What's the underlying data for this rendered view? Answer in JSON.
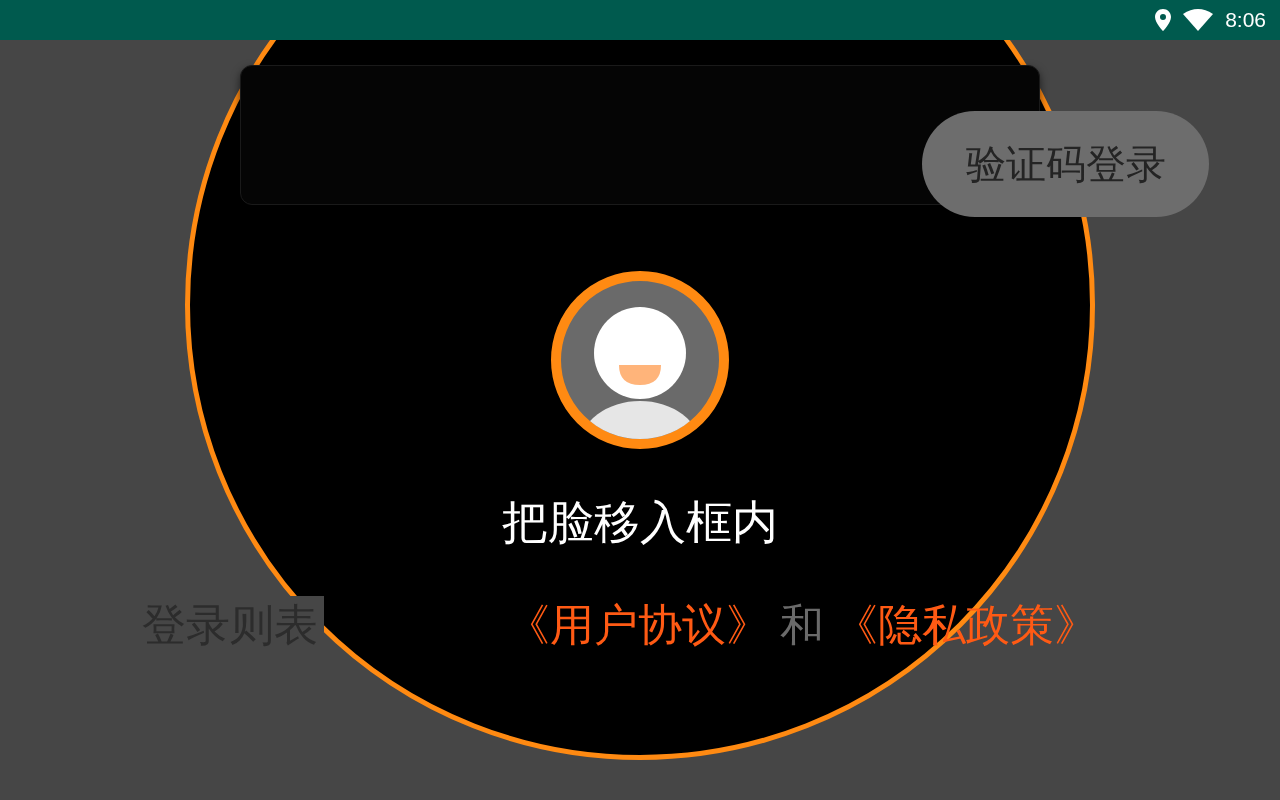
{
  "status_bar": {
    "time": "8:06"
  },
  "sms_login_button": {
    "label": "验证码登录"
  },
  "face_scan": {
    "prompt": "把脸移入框内"
  },
  "agreement": {
    "prefix": "登录则表",
    "segments": [
      {
        "kind": "link",
        "text": "《用户协议》"
      },
      {
        "kind": "text",
        "text": "和"
      },
      {
        "kind": "link",
        "text": "《隐私政策》"
      }
    ]
  }
}
